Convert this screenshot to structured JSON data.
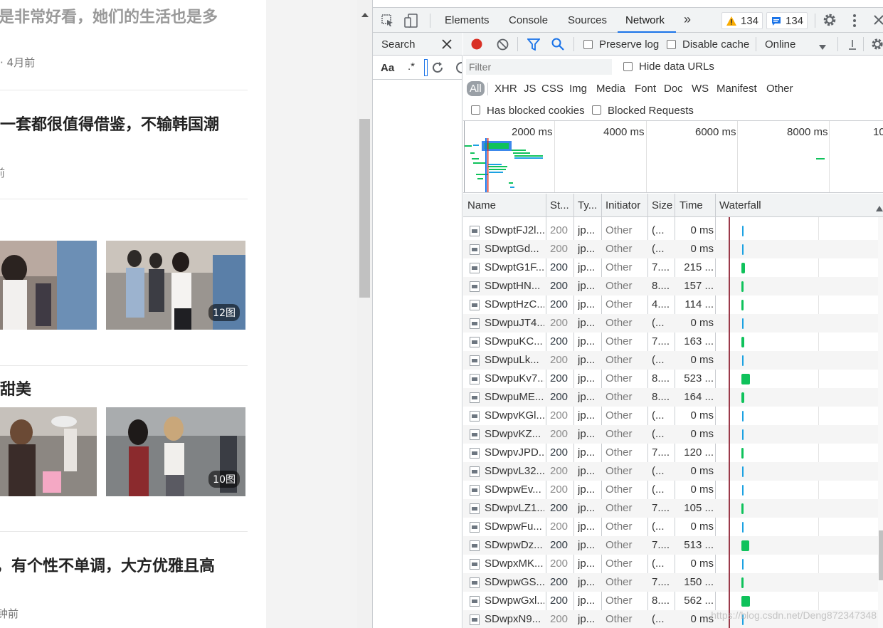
{
  "page": {
    "lines": [
      {
        "text": "是非常好看，她们的生活也是多",
        "kind": "title"
      },
      {
        "text": "· 4月前",
        "kind": "meta"
      },
      {
        "text": "一套都很值得借鉴，不输韩国潮",
        "kind": "title"
      },
      {
        "text": "前",
        "kind": "meta"
      },
      {
        "text": "甜美",
        "kind": "title"
      },
      {
        "text": "，有个性不单调，大方优雅且高",
        "kind": "title"
      },
      {
        "text": "钟前",
        "kind": "meta"
      }
    ],
    "badges": [
      "12图",
      "10图"
    ]
  },
  "devtools": {
    "tabs": [
      "Elements",
      "Console",
      "Sources",
      "Network"
    ],
    "active_tab": "Network",
    "more_tabs": "»",
    "warnings_count": "134",
    "messages_count": "134",
    "search_title": "Search",
    "search_case": "Aa",
    "search_regex": ".*",
    "network": {
      "preserve_log": "Preserve log",
      "disable_cache": "Disable cache",
      "throttling": "Online",
      "filter_placeholder": "Filter",
      "hide_data_urls": "Hide data URLs",
      "types": [
        "All",
        "XHR",
        "JS",
        "CSS",
        "Img",
        "Media",
        "Font",
        "Doc",
        "WS",
        "Manifest",
        "Other"
      ],
      "active_type": "All",
      "has_blocked_cookies": "Has blocked cookies",
      "blocked_requests": "Blocked Requests",
      "overview_labels": [
        "2000 ms",
        "4000 ms",
        "6000 ms",
        "8000 ms",
        "10"
      ],
      "columns": [
        "Name",
        "St...",
        "Ty...",
        "Initiator",
        "Size",
        "Time",
        "Waterfall"
      ],
      "rows": [
        {
          "name": "SDwptFJ2l...",
          "status": "200",
          "type": "jp...",
          "initiator": "Other",
          "size": "(...",
          "time": "0 ms",
          "wf_ms": 0
        },
        {
          "name": "SDwptGd...",
          "status": "200",
          "type": "jp...",
          "initiator": "Other",
          "size": "(...",
          "time": "0 ms",
          "wf_ms": 0
        },
        {
          "name": "SDwptG1F...",
          "status": "200",
          "type": "jp...",
          "initiator": "Other",
          "size": "7....",
          "time": "215 ...",
          "wf_ms": 215
        },
        {
          "name": "SDwptHN...",
          "status": "200",
          "type": "jp...",
          "initiator": "Other",
          "size": "8....",
          "time": "157 ...",
          "wf_ms": 157
        },
        {
          "name": "SDwptHzC...",
          "status": "200",
          "type": "jp...",
          "initiator": "Other",
          "size": "4....",
          "time": "114 ...",
          "wf_ms": 114
        },
        {
          "name": "SDwpuJT4...",
          "status": "200",
          "type": "jp...",
          "initiator": "Other",
          "size": "(...",
          "time": "0 ms",
          "wf_ms": 0
        },
        {
          "name": "SDwpuKC...",
          "status": "200",
          "type": "jp...",
          "initiator": "Other",
          "size": "7....",
          "time": "163 ...",
          "wf_ms": 163
        },
        {
          "name": "SDwpuLk...",
          "status": "200",
          "type": "jp...",
          "initiator": "Other",
          "size": "(...",
          "time": "0 ms",
          "wf_ms": 0
        },
        {
          "name": "SDwpuKv7...",
          "status": "200",
          "type": "jp...",
          "initiator": "Other",
          "size": "8....",
          "time": "523 ...",
          "wf_ms": 523
        },
        {
          "name": "SDwpuME...",
          "status": "200",
          "type": "jp...",
          "initiator": "Other",
          "size": "8....",
          "time": "164 ...",
          "wf_ms": 164
        },
        {
          "name": "SDwpvKGl...",
          "status": "200",
          "type": "jp...",
          "initiator": "Other",
          "size": "(...",
          "time": "0 ms",
          "wf_ms": 0
        },
        {
          "name": "SDwpvKZ...",
          "status": "200",
          "type": "jp...",
          "initiator": "Other",
          "size": "(...",
          "time": "0 ms",
          "wf_ms": 0
        },
        {
          "name": "SDwpvJPD...",
          "status": "200",
          "type": "jp...",
          "initiator": "Other",
          "size": "7....",
          "time": "120 ...",
          "wf_ms": 120
        },
        {
          "name": "SDwpvL32...",
          "status": "200",
          "type": "jp...",
          "initiator": "Other",
          "size": "(...",
          "time": "0 ms",
          "wf_ms": 0
        },
        {
          "name": "SDwpwEv...",
          "status": "200",
          "type": "jp...",
          "initiator": "Other",
          "size": "(...",
          "time": "0 ms",
          "wf_ms": 0
        },
        {
          "name": "SDwpvLZ1...",
          "status": "200",
          "type": "jp...",
          "initiator": "Other",
          "size": "7....",
          "time": "105 ...",
          "wf_ms": 105
        },
        {
          "name": "SDwpwFu...",
          "status": "200",
          "type": "jp...",
          "initiator": "Other",
          "size": "(...",
          "time": "0 ms",
          "wf_ms": 0
        },
        {
          "name": "SDwpwDz...",
          "status": "200",
          "type": "jp...",
          "initiator": "Other",
          "size": "7....",
          "time": "513 ...",
          "wf_ms": 513
        },
        {
          "name": "SDwpxMK...",
          "status": "200",
          "type": "jp...",
          "initiator": "Other",
          "size": "(...",
          "time": "0 ms",
          "wf_ms": 0
        },
        {
          "name": "SDwpwGS...",
          "status": "200",
          "type": "jp...",
          "initiator": "Other",
          "size": "7....",
          "time": "150 ...",
          "wf_ms": 150
        },
        {
          "name": "SDwpwGxl...",
          "status": "200",
          "type": "jp...",
          "initiator": "Other",
          "size": "8....",
          "time": "562 ...",
          "wf_ms": 562
        },
        {
          "name": "SDwpxN9...",
          "status": "200",
          "type": "jp...",
          "initiator": "Other",
          "size": "(...",
          "time": "0 ms",
          "wf_ms": 0
        }
      ]
    },
    "watermark": "https://blog.csdn.net/Deng872347348"
  },
  "colors": {
    "accent": "#1a73e8",
    "record": "#d93025",
    "cached_bar": "#1ba1e2",
    "network_bar": "#0fc25b",
    "dom_line": "#9b3a4a",
    "warning": "#f9ab00"
  }
}
